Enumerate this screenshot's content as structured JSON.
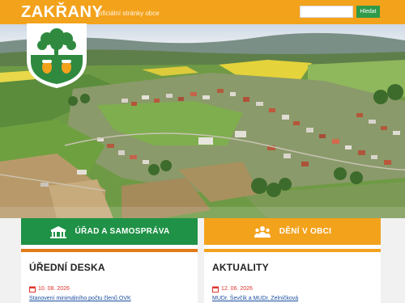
{
  "header": {
    "brand": "ZAKŘANY",
    "tagline": "oficiální stránky obce",
    "search_placeholder": "",
    "search_button": "Hledat"
  },
  "colors": {
    "orange": "#f3a21c",
    "green": "#209247",
    "date_red": "#e0352b",
    "link_blue": "#1a4e9e"
  },
  "cards": [
    {
      "band_label": "ÚŘAD A SAMOSPRÁVA",
      "band_icon": "town-hall-icon",
      "section_title": "ÚŘEDNÍ DESKA",
      "date": "10. 08. 2026",
      "item_title": "Stanovení minimálního počtu členů OVK"
    },
    {
      "band_label": "DĚNÍ V OBCI",
      "band_icon": "people-icon",
      "section_title": "AKTUALITY",
      "date": "12. 06. 2026",
      "item_title": "MUDr. Ševčík a MUDr. Zelníčková"
    }
  ]
}
